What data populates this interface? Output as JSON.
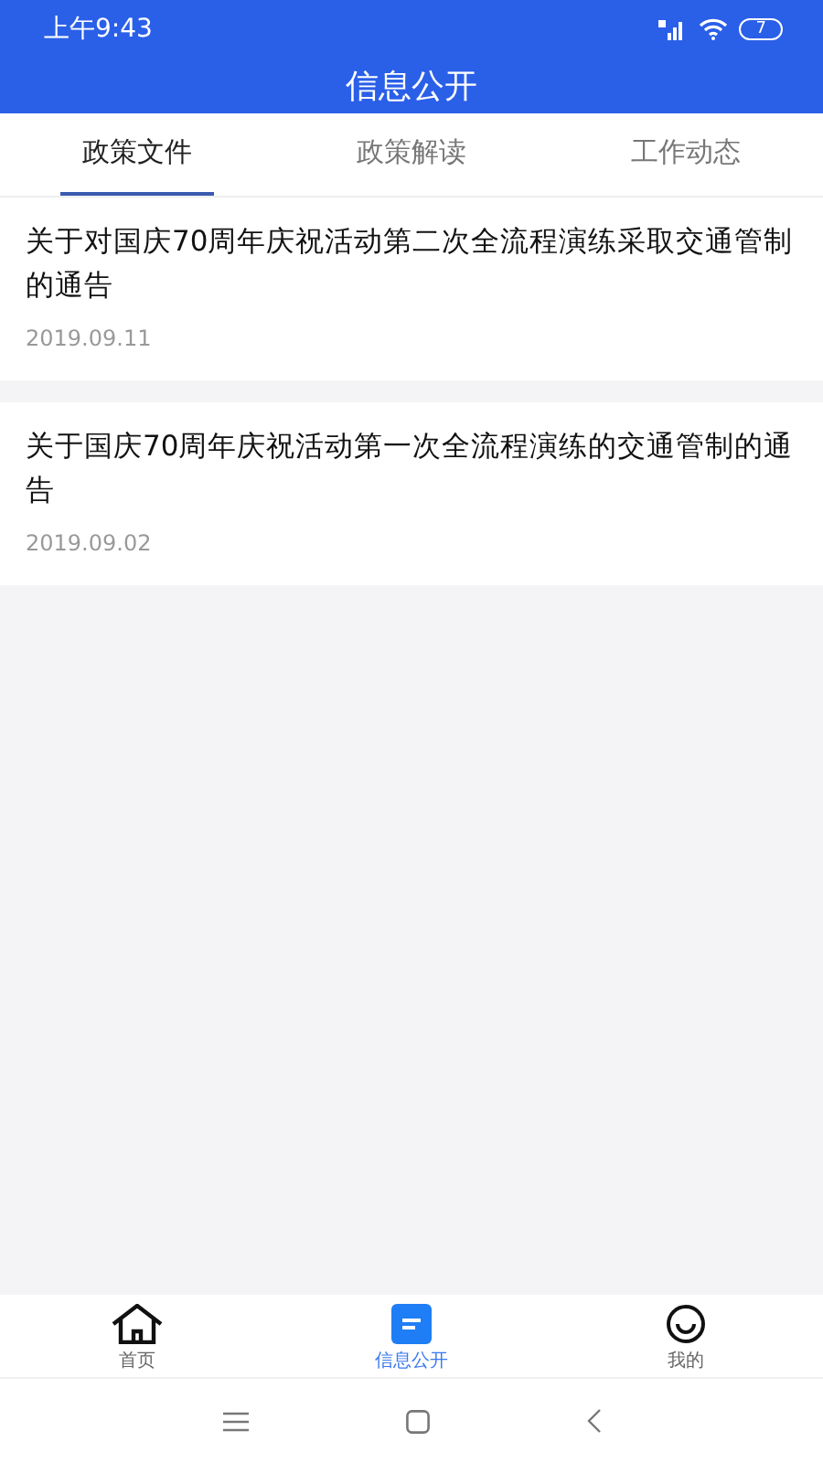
{
  "status_bar": {
    "time": "上午9:43",
    "battery": "7"
  },
  "header": {
    "title": "信息公开"
  },
  "tabs": [
    {
      "label": "政策文件",
      "selected": true
    },
    {
      "label": "政策解读",
      "selected": false
    },
    {
      "label": "工作动态",
      "selected": false
    }
  ],
  "articles": [
    {
      "title": "关于对国庆70周年庆祝活动第二次全流程演练采取交通管制的通告",
      "date": "2019.09.11"
    },
    {
      "title": "关于国庆70周年庆祝活动第一次全流程演练的交通管制的通告",
      "date": "2019.09.02"
    }
  ],
  "bottom_nav": [
    {
      "label": "首页",
      "kind": "home",
      "selected": false
    },
    {
      "label": "信息公开",
      "kind": "info",
      "selected": true
    },
    {
      "label": "我的",
      "kind": "me",
      "selected": false
    }
  ]
}
